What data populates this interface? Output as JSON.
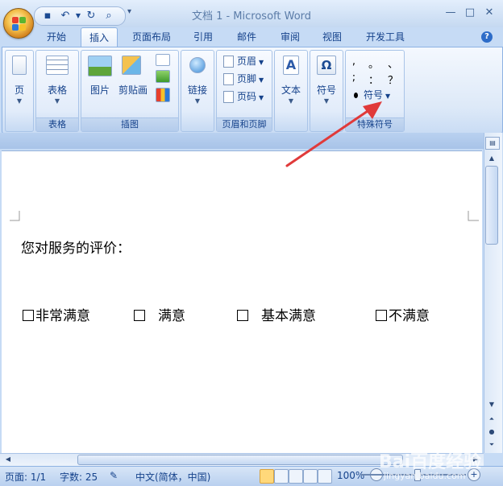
{
  "window": {
    "title": "文档 1 - Microsoft Word"
  },
  "tabs": [
    {
      "label": "开始"
    },
    {
      "label": "插入",
      "active": true
    },
    {
      "label": "页面布局"
    },
    {
      "label": "引用"
    },
    {
      "label": "邮件"
    },
    {
      "label": "审阅"
    },
    {
      "label": "视图"
    },
    {
      "label": "开发工具"
    }
  ],
  "ribbon": {
    "page_button": "页",
    "table_button": "表格",
    "table_group": "表格",
    "picture_button": "图片",
    "clipart_button": "剪贴画",
    "illustrations_group": "插图",
    "link_button": "链接",
    "header_button": "页眉",
    "footer_button": "页脚",
    "page_number_button": "页码",
    "header_footer_group": "页眉和页脚",
    "text_button": "文本",
    "symbol_button": "符号",
    "special_symbols": [
      ",",
      "。",
      "、",
      ";",
      "：",
      "？"
    ],
    "special_symbol_button": "符号",
    "special_symbols_group": "特殊符号"
  },
  "document": {
    "prompt": "您对服务的评价：",
    "options": [
      "非常满意",
      "满意",
      "基本满意",
      "不满意"
    ]
  },
  "status": {
    "page": "页面: 1/1",
    "words": "字数: 25",
    "language": "中文(简体，中国)",
    "zoom": "100%"
  },
  "watermark": {
    "logo": "Bai百度经验",
    "url": "jingyan.baidu.com"
  },
  "colors": {
    "accent": "#15428b",
    "ribbon": "#dde9f8",
    "annotation_arrow": "#e03a3a"
  }
}
